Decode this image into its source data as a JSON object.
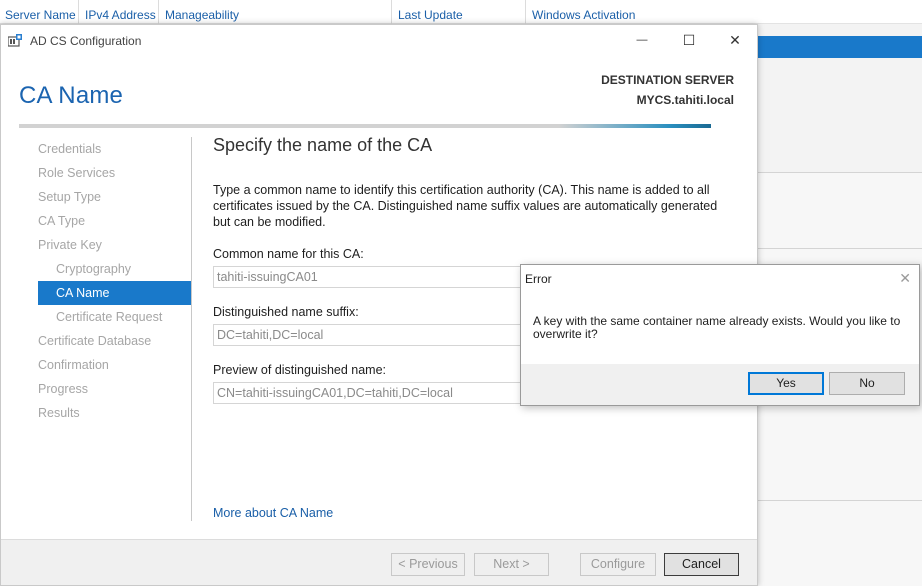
{
  "background": {
    "columns": [
      "Server Name",
      "IPv4 Address",
      "Manageability",
      "Last Update",
      "Windows Activation"
    ]
  },
  "window": {
    "title": "AD CS Configuration",
    "icon": "adcs-config-icon",
    "controls": {
      "minimize": "—",
      "maximize": "☐",
      "close": "✕"
    }
  },
  "header": {
    "page_title": "CA Name",
    "destination_label": "DESTINATION SERVER",
    "destination_value": "MYCS.tahiti.local"
  },
  "nav": {
    "items": [
      {
        "label": "Credentials"
      },
      {
        "label": "Role Services"
      },
      {
        "label": "Setup Type"
      },
      {
        "label": "CA Type"
      },
      {
        "label": "Private Key"
      },
      {
        "label": "Cryptography"
      },
      {
        "label": "CA Name"
      },
      {
        "label": "Certificate Request"
      },
      {
        "label": "Certificate Database"
      },
      {
        "label": "Confirmation"
      },
      {
        "label": "Progress"
      },
      {
        "label": "Results"
      }
    ],
    "active": "CA Name"
  },
  "main": {
    "title": "Specify the name of the CA",
    "description": "Type a common name to identify this certification authority (CA). This name is added to all certificates issued by the CA. Distinguished name suffix values are automatically generated but can be modified.",
    "common_name_label": "Common name for this CA:",
    "common_name_value": "tahiti-issuingCA01",
    "dn_suffix_label": "Distinguished name suffix:",
    "dn_suffix_value": "DC=tahiti,DC=local",
    "preview_label": "Preview of distinguished name:",
    "preview_value": "CN=tahiti-issuingCA01,DC=tahiti,DC=local",
    "more_link": "More about CA Name"
  },
  "footer": {
    "previous": "< Previous",
    "next": "Next >",
    "configure": "Configure",
    "cancel": "Cancel"
  },
  "dialog": {
    "title": "Error",
    "message": "A key with the same container name already exists. Would you like to overwrite it?",
    "yes": "Yes",
    "no": "No",
    "close": "✕"
  },
  "colors": {
    "accent": "#1979ca",
    "title_blue": "#1b64b0",
    "link": "#1a5fa8"
  }
}
